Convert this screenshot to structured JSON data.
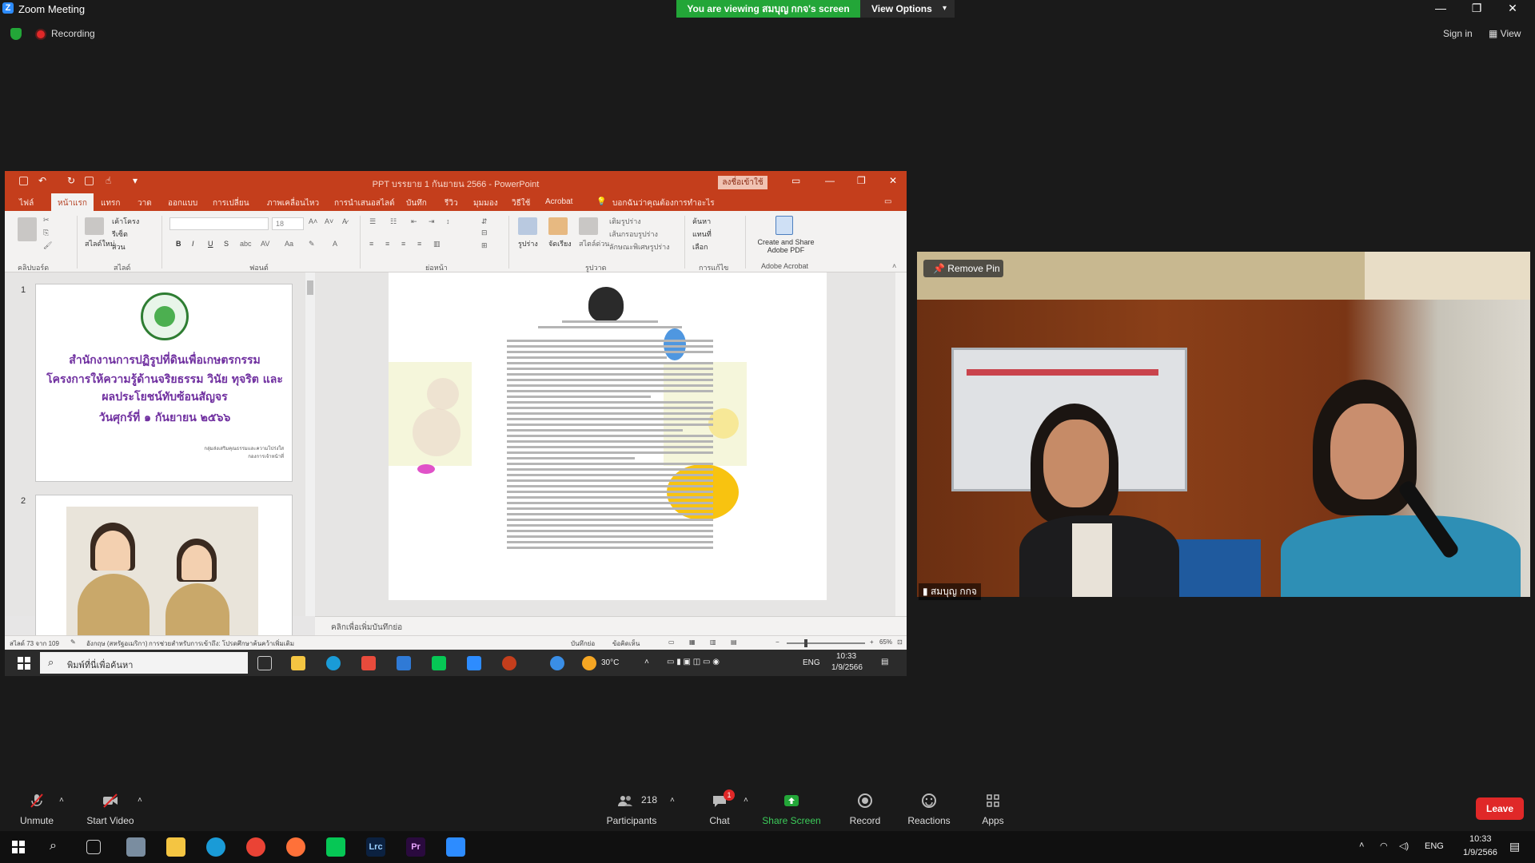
{
  "zoom": {
    "app_title": "Zoom Meeting",
    "viewing_banner": "You are viewing สมบุญ กกจ's screen",
    "view_options": "View Options",
    "recording": "Recording",
    "sign_in": "Sign in",
    "view": "View"
  },
  "powerpoint": {
    "title": "PPT บรรยาย 1 กันยายน 2566  -  PowerPoint",
    "signin_btn": "ลงชื่อเข้าใช้",
    "tabs": [
      "ไฟล์",
      "หน้าแรก",
      "แทรก",
      "วาด",
      "ออกแบบ",
      "การเปลี่ยน",
      "ภาพเคลื่อนไหว",
      "การนำเสนอสไลด์",
      "บันทึก",
      "รีวิว",
      "มุมมอง",
      "วิธีใช้",
      "Acrobat"
    ],
    "tell_me": "บอกฉันว่าคุณต้องการทำอะไร",
    "ribbon": {
      "clipboard": "คลิปบอร์ด",
      "slides": "สไลด์",
      "new_slide": "สไลด์ใหม่",
      "layout": "เค้าโครง",
      "reset": "รีเซ็ต",
      "section": "ส่วน",
      "font_group": "ฟอนต์",
      "font_size": "18",
      "paragraph": "ย่อหน้า",
      "drawing": "รูปวาด",
      "shapes": "รูปร่าง",
      "arrange": "จัดเรียง",
      "quick_styles": "สไตล์ด่วน",
      "shape_fill": "เติมรูปร่าง",
      "shape_outline": "เส้นกรอบรูปร่าง",
      "shape_effects": "ลักษณะพิเศษรูปร่าง",
      "editing": "การแก้ไข",
      "find": "ค้นหา",
      "replace": "แทนที่",
      "select": "เลือก",
      "create_share": "Create and Share Adobe PDF",
      "adobe": "Adobe Acrobat"
    },
    "thumb1": {
      "number": "1",
      "line1": "สำนักงานการปฏิรูปที่ดินเพื่อเกษตรกรรม",
      "line2": "โครงการให้ความรู้ด้านจริยธรรม วินัย ทุจริต และ",
      "line3": "ผลประโยชน์ทับซ้อนสัญจร",
      "line4": "วันศุกร์ที่ ๑ กันยายน ๒๕๖๖",
      "foot1": "กลุ่มส่งเสริมคุณธรรมและความโปร่งใส",
      "foot2": "กองการเจ้าหน้าที่"
    },
    "thumb2_number": "2",
    "notes_placeholder": "คลิกเพื่อเพิ่มบันทึกย่อ",
    "status": {
      "slide_count": "สไลด์ 73 จาก 109",
      "language": "อังกฤษ (สหรัฐอเมริกา)",
      "accessibility": "การช่วยสำหรับการเข้าถึง: โปรดศึกษาค้นคว้าเพิ่มเติม",
      "notes": "บันทึกย่อ",
      "comments": "ข้อคิดเห็น",
      "zoom": "65%"
    },
    "taskbar": {
      "search": "พิมพ์ที่นี่เพื่อค้นหา",
      "weather": "30°C",
      "lang": "ENG",
      "time": "10:33",
      "date": "1/9/2566"
    }
  },
  "video": {
    "remove_pin": "Remove Pin",
    "participant": "สมบุญ กกจ"
  },
  "controls": {
    "unmute": "Unmute",
    "start_video": "Start Video",
    "participants": "Participants",
    "participants_count": "218",
    "chat": "Chat",
    "chat_badge": "1",
    "share_screen": "Share Screen",
    "record": "Record",
    "reactions": "Reactions",
    "apps": "Apps",
    "leave": "Leave"
  },
  "host_taskbar": {
    "lrc": "Lrc",
    "pr": "Pr",
    "lang": "ENG",
    "time": "10:33",
    "date": "1/9/2566"
  },
  "colors": {
    "zoom_green": "#23a638",
    "ppt_red": "#c43e1c",
    "leave_red": "#e02828",
    "thumb_purple": "#7030a0"
  }
}
